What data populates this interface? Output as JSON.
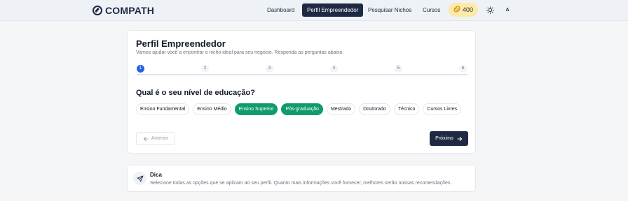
{
  "header": {
    "logo": "COMPATH",
    "nav": [
      "Dashboard",
      "Perfil Empreendedor",
      "Pesquisar Nichos",
      "Cursos"
    ],
    "active_nav": "Perfil Empreendedor",
    "coins": "400",
    "avatar": "A",
    "icons": {
      "logo": "compass-icon",
      "coins": "coins-icon",
      "theme": "sun-icon"
    }
  },
  "card": {
    "title": "Perfil Empreendedor",
    "subtitle": "Vamos ajudar você a encontrar o nicho ideal para seu negócio. Responda as perguntas abaixo.",
    "steps": [
      "1",
      "2",
      "3",
      "4",
      "5",
      "6"
    ],
    "current_step": "1",
    "question": "Qual é o seu nível de educação?",
    "options": [
      {
        "label": "Ensino Fundamental",
        "selected": false
      },
      {
        "label": "Ensino Médio",
        "selected": false
      },
      {
        "label": "Ensino Superior",
        "selected": true
      },
      {
        "label": "Pós-graduação",
        "selected": true
      },
      {
        "label": "Mestrado",
        "selected": false
      },
      {
        "label": "Doutorado",
        "selected": false
      },
      {
        "label": "Técnico",
        "selected": false
      },
      {
        "label": "Cursos Livres",
        "selected": false
      }
    ],
    "prev_label": "Anterior",
    "next_label": "Próximo"
  },
  "tip": {
    "title": "Dica",
    "text": "Selecione todas as opções que se aplicam ao seu perfil. Quanto mais informações você fornecer, melhores serão nossas recomendações."
  },
  "colors": {
    "brand": "#1e2a44",
    "selected": "#0f9b6a",
    "active_step": "#2563eb",
    "coins_bg": "#fde9a8"
  }
}
